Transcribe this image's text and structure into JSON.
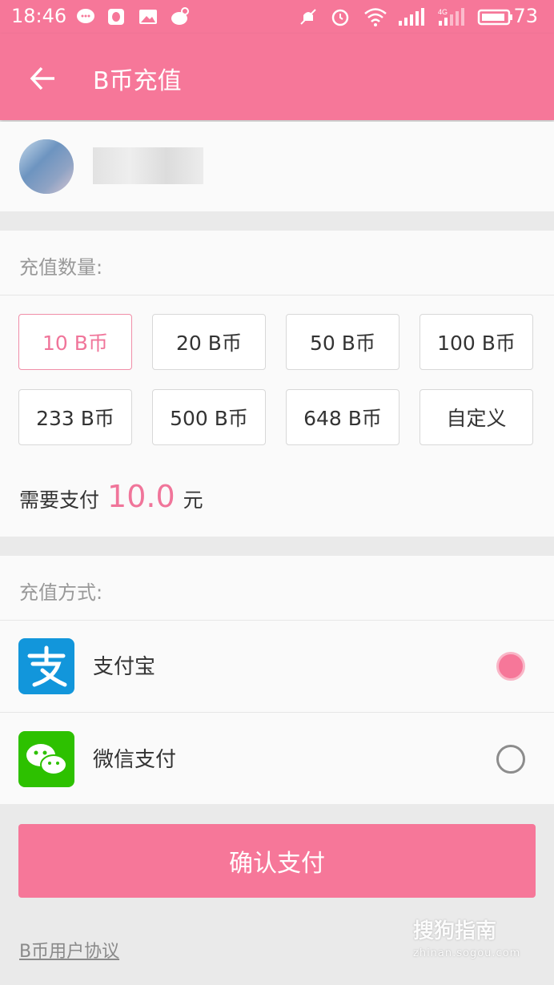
{
  "status_bar": {
    "time": "18:46",
    "battery": "73"
  },
  "app_bar": {
    "title": "B币充值"
  },
  "amount_section": {
    "label": "充值数量:",
    "options": [
      {
        "label": "10 B币",
        "selected": true
      },
      {
        "label": "20 B币",
        "selected": false
      },
      {
        "label": "50 B币",
        "selected": false
      },
      {
        "label": "100 B币",
        "selected": false
      },
      {
        "label": "233 B币",
        "selected": false
      },
      {
        "label": "500 B币",
        "selected": false
      },
      {
        "label": "648 B币",
        "selected": false
      },
      {
        "label": "自定义",
        "selected": false
      }
    ],
    "need_pay_prefix": "需要支付",
    "need_pay_value": "10.0",
    "need_pay_unit": "元"
  },
  "method_section": {
    "label": "充值方式:",
    "methods": [
      {
        "label": "支付宝",
        "icon": "alipay-icon",
        "selected": true
      },
      {
        "label": "微信支付",
        "icon": "wechat-pay-icon",
        "selected": false
      }
    ]
  },
  "confirm_button": "确认支付",
  "agreement_link": "B币用户协议",
  "watermark": {
    "main": "搜狗指南",
    "url": "zhinan.sogou.com"
  },
  "colors": {
    "brand_pink": "#f67799",
    "accent_text": "#f0759a",
    "alipay_blue": "#1296db",
    "wechat_green": "#2dc100"
  }
}
